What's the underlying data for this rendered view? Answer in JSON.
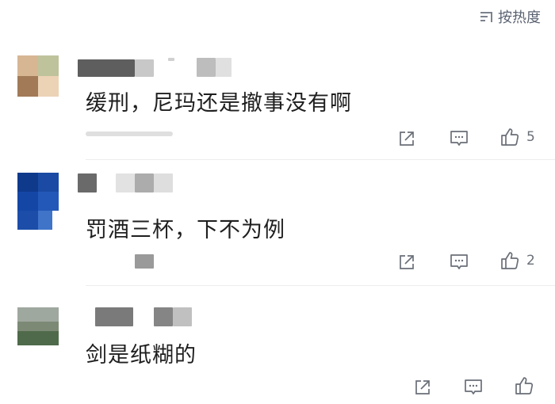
{
  "sort": {
    "label": "按热度",
    "icon": "sort-icon"
  },
  "comments": [
    {
      "text": "缓刑，尼玛还是撤事没有啊",
      "likes": "5"
    },
    {
      "text": "罚酒三杯，下不为例",
      "likes": "2"
    },
    {
      "text": "剑是纸糊的",
      "likes": ""
    }
  ],
  "icons": {
    "share": "share-icon",
    "reply": "comment-icon",
    "like": "thumbs-up-icon"
  }
}
